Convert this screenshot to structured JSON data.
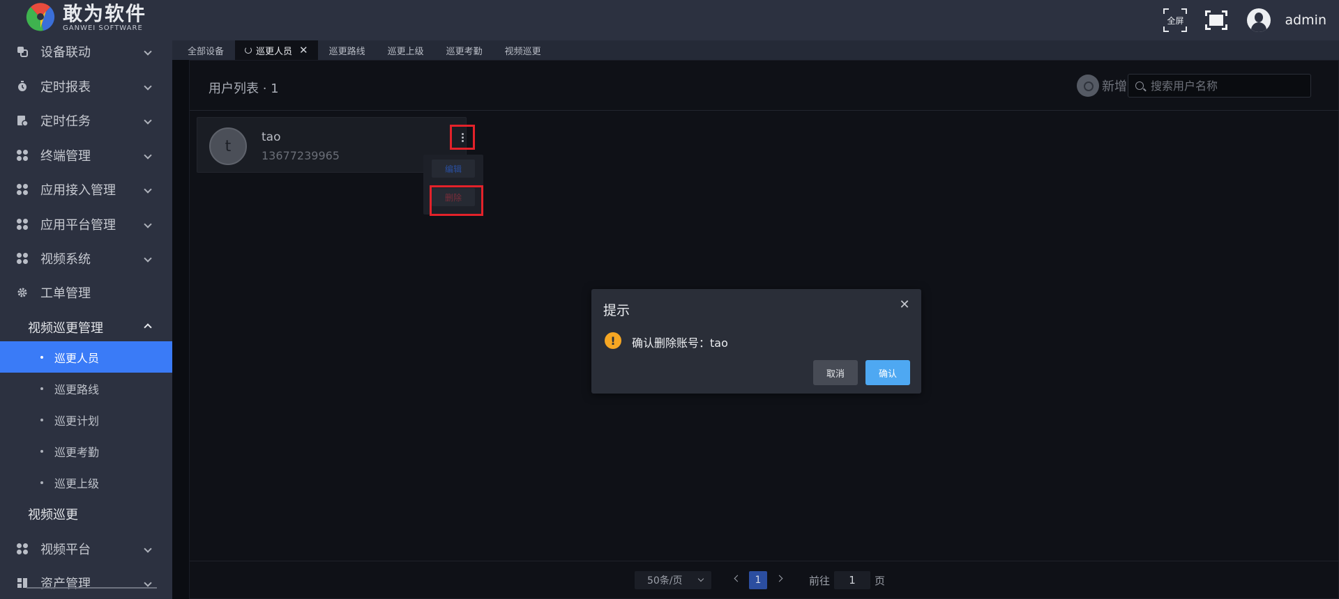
{
  "header": {
    "brand_title": "敢为软件",
    "brand_sub": "GANWEI SOFTWARE",
    "fullscreen_label": "全屏",
    "username": "admin"
  },
  "sidebar": {
    "items": [
      {
        "label": "设备联动",
        "icon": "link-icon"
      },
      {
        "label": "定时报表",
        "icon": "clock-report-icon"
      },
      {
        "label": "定时任务",
        "icon": "task-icon"
      },
      {
        "label": "终端管理",
        "icon": "grid-icon"
      },
      {
        "label": "应用接入管理",
        "icon": "grid-icon"
      },
      {
        "label": "应用平台管理",
        "icon": "grid-icon"
      },
      {
        "label": "视频系统",
        "icon": "grid-icon"
      },
      {
        "label": "工单管理",
        "icon": "gear-icon"
      }
    ],
    "submenu_title": "视频巡更管理",
    "leaves": [
      {
        "label": "巡更人员",
        "active": true
      },
      {
        "label": "巡更路线",
        "active": false
      },
      {
        "label": "巡更计划",
        "active": false
      },
      {
        "label": "巡更考勤",
        "active": false
      },
      {
        "label": "巡更上级",
        "active": false
      }
    ],
    "video_patrol": "视频巡更",
    "video_platform": "视频平台",
    "asset_mgmt": "资产管理"
  },
  "tabs": [
    {
      "label": "全部设备",
      "active": false
    },
    {
      "label": "巡更人员",
      "active": true
    },
    {
      "label": "巡更路线",
      "active": false
    },
    {
      "label": "巡更上级",
      "active": false
    },
    {
      "label": "巡更考勤",
      "active": false
    },
    {
      "label": "视频巡更",
      "active": false
    }
  ],
  "panel": {
    "title": "用户列表 · 1",
    "new_label": "新增",
    "search_placeholder": "搜索用户名称"
  },
  "user_card": {
    "avatar_letter": "t",
    "name": "tao",
    "phone": "13677239965"
  },
  "dropdown": {
    "edit": "编辑",
    "delete": "删除"
  },
  "pagination": {
    "page_size": "50条/页",
    "current_page": "1",
    "goto_label": "前往",
    "goto_value": "1",
    "page_unit": "页"
  },
  "dialog": {
    "title": "提示",
    "message": "确认删除账号：tao",
    "cancel": "取消",
    "confirm": "确认"
  },
  "colors": {
    "accent": "#3a7bf7",
    "highlight": "#e3222a",
    "warning": "#f5a623",
    "confirm": "#4ea8f2"
  }
}
